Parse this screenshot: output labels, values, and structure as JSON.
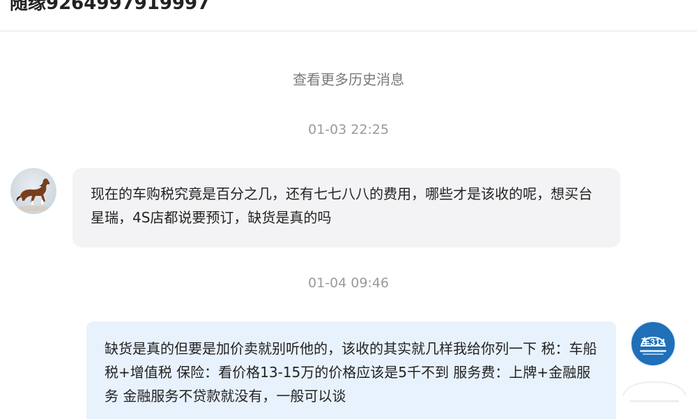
{
  "header": {
    "title": "随缘9264997919997"
  },
  "chat": {
    "history_link": "查看更多历史消息",
    "messages": [
      {
        "time": "01-03 22:25",
        "sender": "user",
        "text": "现在的车购税究竟是百分之几，还有七七八八的费用，哪些才是该收的呢，想买台星瑞，4S店都说要预订，缺货是真的吗"
      },
      {
        "time": "01-04 09:46",
        "sender": "dealer",
        "avatar_label": "车314",
        "text": "缺货是真的但要是加价卖就别听他的，该收的其实就几样我给你列一下 税：车船税+增值税 保险：看价格13-15万的价格应该是5千不到 服务费：上牌+金融服务 金融服务不贷款就没有，一般可以谈"
      }
    ]
  },
  "colors": {
    "user_bubble": "#f3f3f5",
    "dealer_bubble": "#e8f2fd",
    "dealer_avatar": "#1f6fb9"
  }
}
